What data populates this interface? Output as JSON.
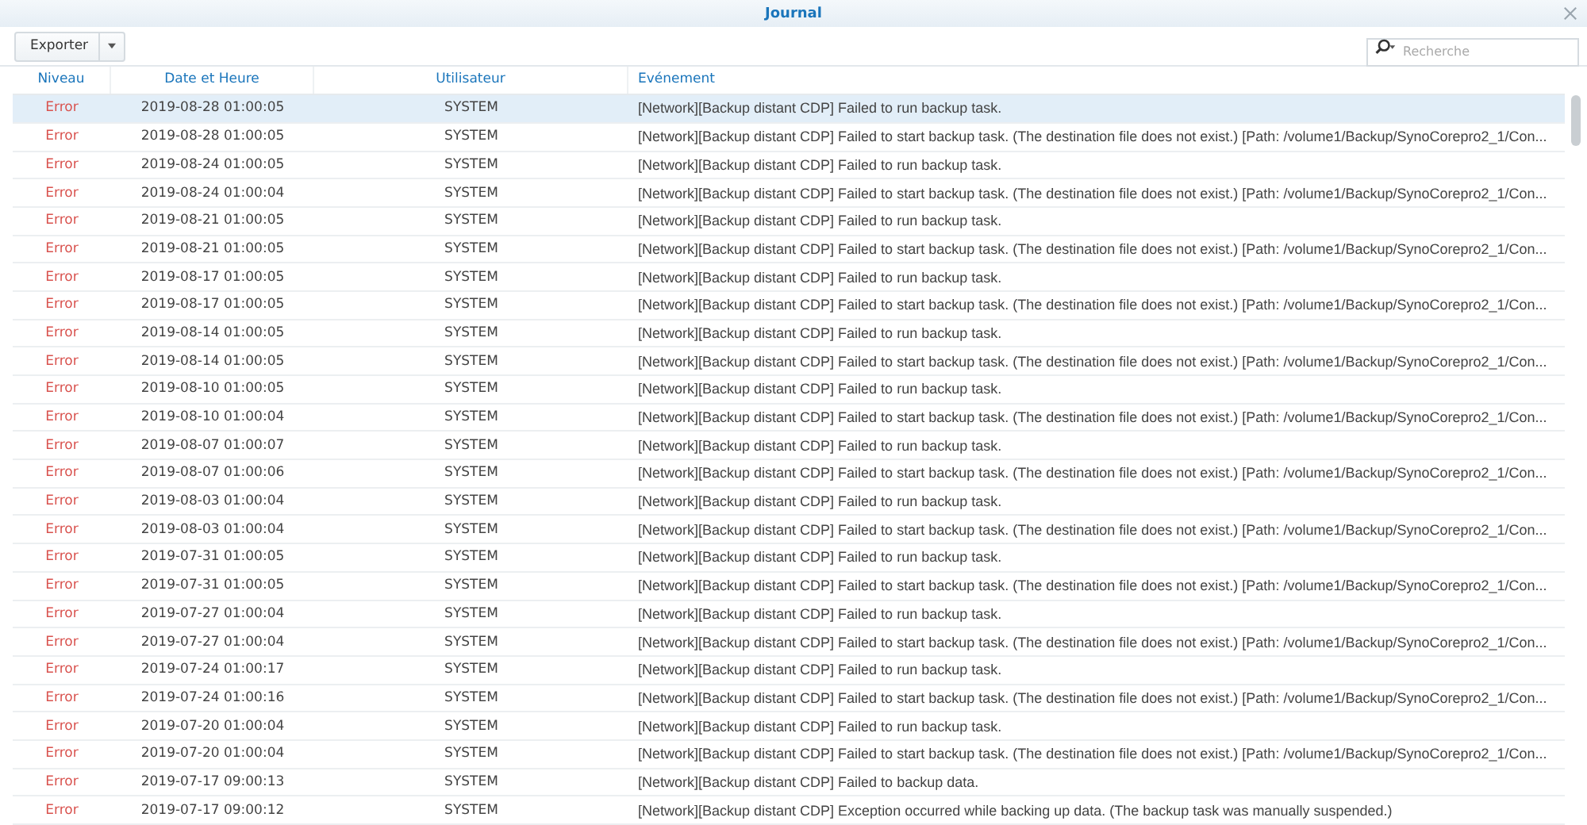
{
  "window": {
    "title": "Journal"
  },
  "toolbar": {
    "export_button": "Exporter",
    "search": {
      "placeholder": "Recherche"
    }
  },
  "table": {
    "columns": [
      "Niveau",
      "Date et Heure",
      "Utilisateur",
      "Evénement"
    ],
    "rows": [
      {
        "level": "Error",
        "kind": "error",
        "datetime": "2019-08-28 01:00:05",
        "user": "SYSTEM",
        "event": "[Network][Backup distant CDP] Failed to run backup task.",
        "selected": true
      },
      {
        "level": "Error",
        "kind": "error",
        "datetime": "2019-08-28 01:00:05",
        "user": "SYSTEM",
        "event": "[Network][Backup distant CDP] Failed to start backup task. (The destination file does not exist.) [Path: /volume1/Backup/SynoCorepro2_1/Con...",
        "selected": false
      },
      {
        "level": "Error",
        "kind": "error",
        "datetime": "2019-08-24 01:00:05",
        "user": "SYSTEM",
        "event": "[Network][Backup distant CDP] Failed to run backup task.",
        "selected": false
      },
      {
        "level": "Error",
        "kind": "error",
        "datetime": "2019-08-24 01:00:04",
        "user": "SYSTEM",
        "event": "[Network][Backup distant CDP] Failed to start backup task. (The destination file does not exist.) [Path: /volume1/Backup/SynoCorepro2_1/Con...",
        "selected": false
      },
      {
        "level": "Error",
        "kind": "error",
        "datetime": "2019-08-21 01:00:05",
        "user": "SYSTEM",
        "event": "[Network][Backup distant CDP] Failed to run backup task.",
        "selected": false
      },
      {
        "level": "Error",
        "kind": "error",
        "datetime": "2019-08-21 01:00:05",
        "user": "SYSTEM",
        "event": "[Network][Backup distant CDP] Failed to start backup task. (The destination file does not exist.) [Path: /volume1/Backup/SynoCorepro2_1/Con...",
        "selected": false
      },
      {
        "level": "Error",
        "kind": "error",
        "datetime": "2019-08-17 01:00:05",
        "user": "SYSTEM",
        "event": "[Network][Backup distant CDP] Failed to run backup task.",
        "selected": false
      },
      {
        "level": "Error",
        "kind": "error",
        "datetime": "2019-08-17 01:00:05",
        "user": "SYSTEM",
        "event": "[Network][Backup distant CDP] Failed to start backup task. (The destination file does not exist.) [Path: /volume1/Backup/SynoCorepro2_1/Con...",
        "selected": false
      },
      {
        "level": "Error",
        "kind": "error",
        "datetime": "2019-08-14 01:00:05",
        "user": "SYSTEM",
        "event": "[Network][Backup distant CDP] Failed to run backup task.",
        "selected": false
      },
      {
        "level": "Error",
        "kind": "error",
        "datetime": "2019-08-14 01:00:05",
        "user": "SYSTEM",
        "event": "[Network][Backup distant CDP] Failed to start backup task. (The destination file does not exist.) [Path: /volume1/Backup/SynoCorepro2_1/Con...",
        "selected": false
      },
      {
        "level": "Error",
        "kind": "error",
        "datetime": "2019-08-10 01:00:05",
        "user": "SYSTEM",
        "event": "[Network][Backup distant CDP] Failed to run backup task.",
        "selected": false
      },
      {
        "level": "Error",
        "kind": "error",
        "datetime": "2019-08-10 01:00:04",
        "user": "SYSTEM",
        "event": "[Network][Backup distant CDP] Failed to start backup task. (The destination file does not exist.) [Path: /volume1/Backup/SynoCorepro2_1/Con...",
        "selected": false
      },
      {
        "level": "Error",
        "kind": "error",
        "datetime": "2019-08-07 01:00:07",
        "user": "SYSTEM",
        "event": "[Network][Backup distant CDP] Failed to run backup task.",
        "selected": false
      },
      {
        "level": "Error",
        "kind": "error",
        "datetime": "2019-08-07 01:00:06",
        "user": "SYSTEM",
        "event": "[Network][Backup distant CDP] Failed to start backup task. (The destination file does not exist.) [Path: /volume1/Backup/SynoCorepro2_1/Con...",
        "selected": false
      },
      {
        "level": "Error",
        "kind": "error",
        "datetime": "2019-08-03 01:00:04",
        "user": "SYSTEM",
        "event": "[Network][Backup distant CDP] Failed to run backup task.",
        "selected": false
      },
      {
        "level": "Error",
        "kind": "error",
        "datetime": "2019-08-03 01:00:04",
        "user": "SYSTEM",
        "event": "[Network][Backup distant CDP] Failed to start backup task. (The destination file does not exist.) [Path: /volume1/Backup/SynoCorepro2_1/Con...",
        "selected": false
      },
      {
        "level": "Error",
        "kind": "error",
        "datetime": "2019-07-31 01:00:05",
        "user": "SYSTEM",
        "event": "[Network][Backup distant CDP] Failed to run backup task.",
        "selected": false
      },
      {
        "level": "Error",
        "kind": "error",
        "datetime": "2019-07-31 01:00:05",
        "user": "SYSTEM",
        "event": "[Network][Backup distant CDP] Failed to start backup task. (The destination file does not exist.) [Path: /volume1/Backup/SynoCorepro2_1/Con...",
        "selected": false
      },
      {
        "level": "Error",
        "kind": "error",
        "datetime": "2019-07-27 01:00:04",
        "user": "SYSTEM",
        "event": "[Network][Backup distant CDP] Failed to run backup task.",
        "selected": false
      },
      {
        "level": "Error",
        "kind": "error",
        "datetime": "2019-07-27 01:00:04",
        "user": "SYSTEM",
        "event": "[Network][Backup distant CDP] Failed to start backup task. (The destination file does not exist.) [Path: /volume1/Backup/SynoCorepro2_1/Con...",
        "selected": false
      },
      {
        "level": "Error",
        "kind": "error",
        "datetime": "2019-07-24 01:00:17",
        "user": "SYSTEM",
        "event": "[Network][Backup distant CDP] Failed to run backup task.",
        "selected": false
      },
      {
        "level": "Error",
        "kind": "error",
        "datetime": "2019-07-24 01:00:16",
        "user": "SYSTEM",
        "event": "[Network][Backup distant CDP] Failed to start backup task. (The destination file does not exist.) [Path: /volume1/Backup/SynoCorepro2_1/Con...",
        "selected": false
      },
      {
        "level": "Error",
        "kind": "error",
        "datetime": "2019-07-20 01:00:04",
        "user": "SYSTEM",
        "event": "[Network][Backup distant CDP] Failed to run backup task.",
        "selected": false
      },
      {
        "level": "Error",
        "kind": "error",
        "datetime": "2019-07-20 01:00:04",
        "user": "SYSTEM",
        "event": "[Network][Backup distant CDP] Failed to start backup task. (The destination file does not exist.) [Path: /volume1/Backup/SynoCorepro2_1/Con...",
        "selected": false
      },
      {
        "level": "Error",
        "kind": "error",
        "datetime": "2019-07-17 09:00:13",
        "user": "SYSTEM",
        "event": "[Network][Backup distant CDP] Failed to backup data.",
        "selected": false
      },
      {
        "level": "Error",
        "kind": "error",
        "datetime": "2019-07-17 09:00:12",
        "user": "SYSTEM",
        "event": "[Network][Backup distant CDP] Exception occurred while backing up data. (The backup task was manually suspended.)",
        "selected": false
      }
    ]
  }
}
